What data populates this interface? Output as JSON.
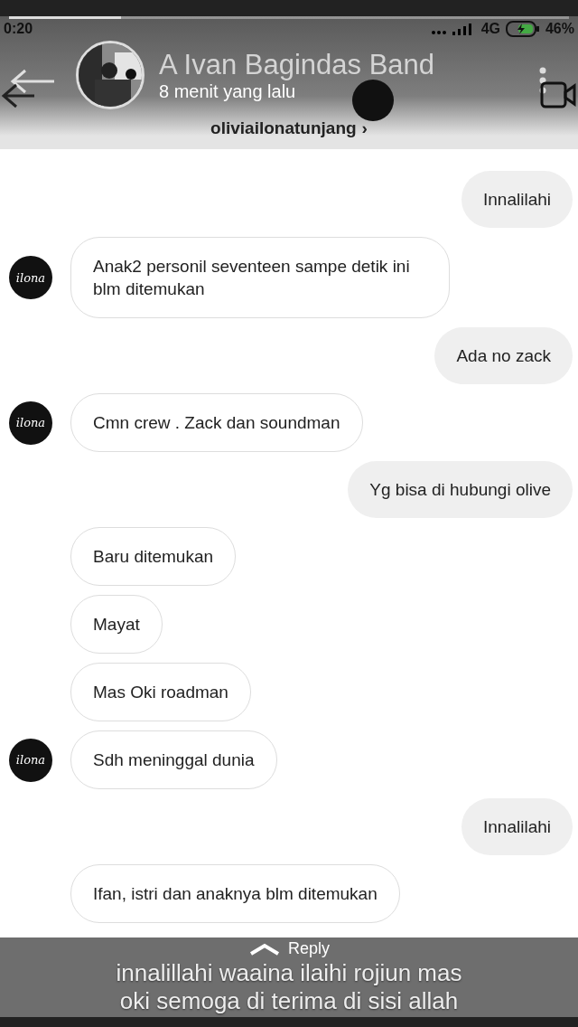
{
  "story": {
    "progress": {
      "level": 0.2
    },
    "status_bar": {
      "time": "0:20",
      "network": "4G",
      "battery": "46%"
    },
    "title": "A Ivan Bagindas Band",
    "subtitle": "8 menit yang lalu",
    "username": "oliviailonatunjang",
    "chevron": "›"
  },
  "messages": [
    {
      "kind": "out",
      "text": "Innalilahi"
    },
    {
      "kind": "in",
      "text": "Anak2 personil seventeen  sampe detik ini blm ditemukan",
      "avatar": "ilona"
    },
    {
      "kind": "out",
      "text": "Ada no zack"
    },
    {
      "kind": "in",
      "text": "Cmn crew . Zack dan soundman",
      "avatar": "ilona"
    },
    {
      "kind": "out",
      "text": "Yg bisa di hubungi olive"
    },
    {
      "kind": "in",
      "text": "Baru ditemukan"
    },
    {
      "kind": "in",
      "text": "Mayat"
    },
    {
      "kind": "in",
      "text": "Mas Oki roadman"
    },
    {
      "kind": "in",
      "text": "Sdh meninggal dunia",
      "avatar": "ilona"
    },
    {
      "kind": "out",
      "text": "Innalilahi"
    },
    {
      "kind": "in",
      "text": "Ifan, istri dan anaknya blm ditemukan"
    }
  ],
  "caption": [
    "innalillahi waaina ilaihi rojiun mas",
    "oki semoga di terima di sisi allah"
  ],
  "reply": "Reply"
}
